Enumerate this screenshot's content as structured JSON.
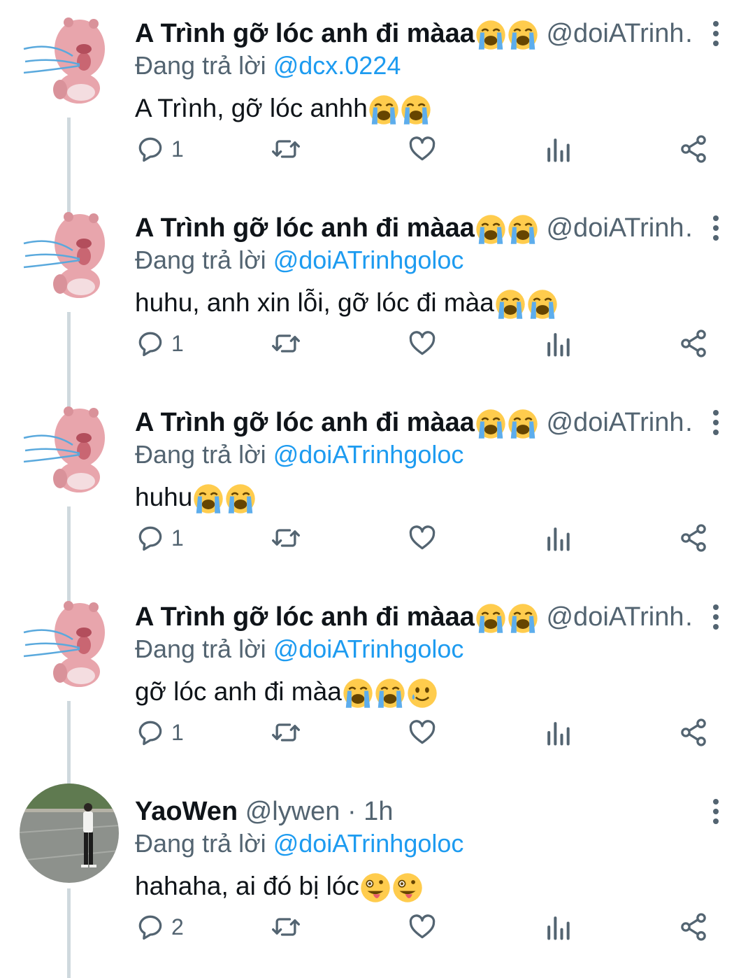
{
  "colors": {
    "text": "#0f1419",
    "muted": "#536471",
    "link": "#1d9bf0",
    "thread": "#cfd9de"
  },
  "tweets": [
    {
      "name": "A Trình gỡ lóc anh đi màaa",
      "handle": "@doiATrinh…",
      "replying_label": "Đang trả lời",
      "replying_to": "@dcx.0224",
      "text": "A Trình, gỡ lóc anhh",
      "reply_count": "1",
      "avatar": "pink-beaver-avatar",
      "emojis_name": [
        "loudly-crying-face",
        "loudly-crying-face"
      ],
      "emojis_text": [
        "loudly-crying-face",
        "loudly-crying-face"
      ]
    },
    {
      "name": "A Trình gỡ lóc anh đi màaa",
      "handle": "@doiATrinh…",
      "replying_label": "Đang trả lời",
      "replying_to": "@doiATrinhgoloc",
      "text": "huhu, anh xin lỗi, gỡ lóc đi màa",
      "reply_count": "1",
      "avatar": "pink-beaver-avatar",
      "emojis_name": [
        "loudly-crying-face",
        "loudly-crying-face"
      ],
      "emojis_text": [
        "loudly-crying-face",
        "loudly-crying-face"
      ]
    },
    {
      "name": "A Trình gỡ lóc anh đi màaa",
      "handle": "@doiATrinh…",
      "replying_label": "Đang trả lời",
      "replying_to": "@doiATrinhgoloc",
      "text": "huhu",
      "reply_count": "1",
      "avatar": "pink-beaver-avatar",
      "emojis_name": [
        "loudly-crying-face",
        "loudly-crying-face"
      ],
      "emojis_text": [
        "loudly-crying-face",
        "loudly-crying-face"
      ]
    },
    {
      "name": "A Trình gỡ lóc anh đi màaa",
      "handle": "@doiATrinh…",
      "replying_label": "Đang trả lời",
      "replying_to": "@doiATrinhgoloc",
      "text": "gỡ lóc anh đi màa",
      "reply_count": "1",
      "avatar": "pink-beaver-avatar",
      "emojis_name": [
        "loudly-crying-face",
        "loudly-crying-face"
      ],
      "emojis_text": [
        "loudly-crying-face",
        "loudly-crying-face",
        "smiling-face-with-tear"
      ]
    },
    {
      "name": "YaoWen",
      "handle": "@lywen · 1h",
      "replying_label": "Đang trả lời",
      "replying_to": "@doiATrinhgoloc",
      "text": "hahaha, ai đó bị lóc",
      "reply_count": "2",
      "avatar": "photo-avatar",
      "emojis_name": [],
      "emojis_text": [
        "zany-face",
        "zany-face"
      ]
    }
  ]
}
